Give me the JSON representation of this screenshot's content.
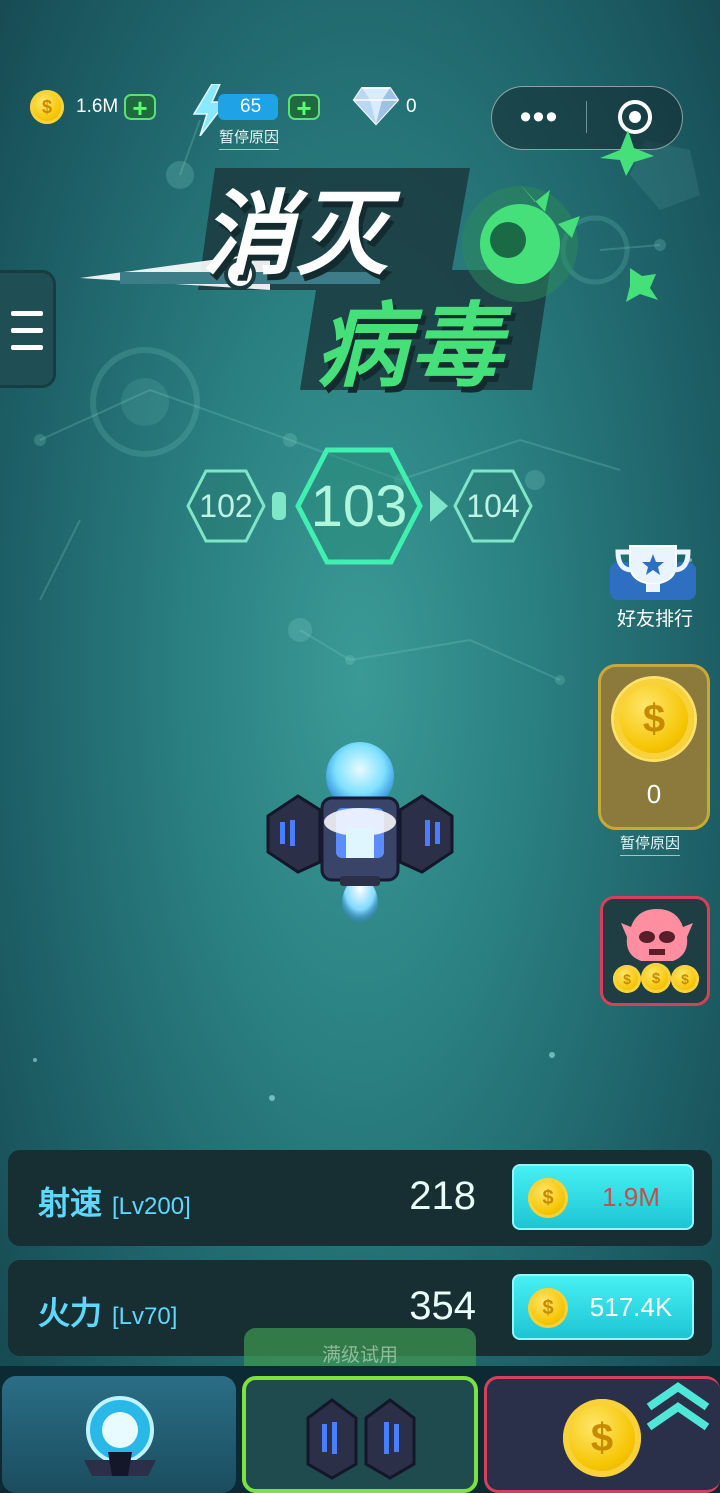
{
  "status": {
    "coins": "1.6M",
    "energy": "65",
    "energy_note": "暂停原因",
    "diamonds": "0"
  },
  "title": {
    "line1": "消灭",
    "line2": "病毒"
  },
  "levels": {
    "prev": "102",
    "current": "103",
    "next": "104"
  },
  "side": {
    "rank_label": "好友排行",
    "coin_reward_count": "0",
    "coin_reward_note": "暂停原因"
  },
  "upgrades": [
    {
      "name": "射速",
      "level": "[Lv200]",
      "value": "218",
      "cost": "1.9M",
      "cost_color": "#c0504d"
    },
    {
      "name": "火力",
      "level": "[Lv70]",
      "value": "354",
      "cost": "517.4K",
      "cost_color": "#ffffff"
    }
  ],
  "tabs": {
    "trial_label": "满级试用"
  },
  "colors": {
    "accent_green": "#5be07a",
    "cyan_button": "#2fdbe4",
    "title_green": "#45e07a"
  }
}
